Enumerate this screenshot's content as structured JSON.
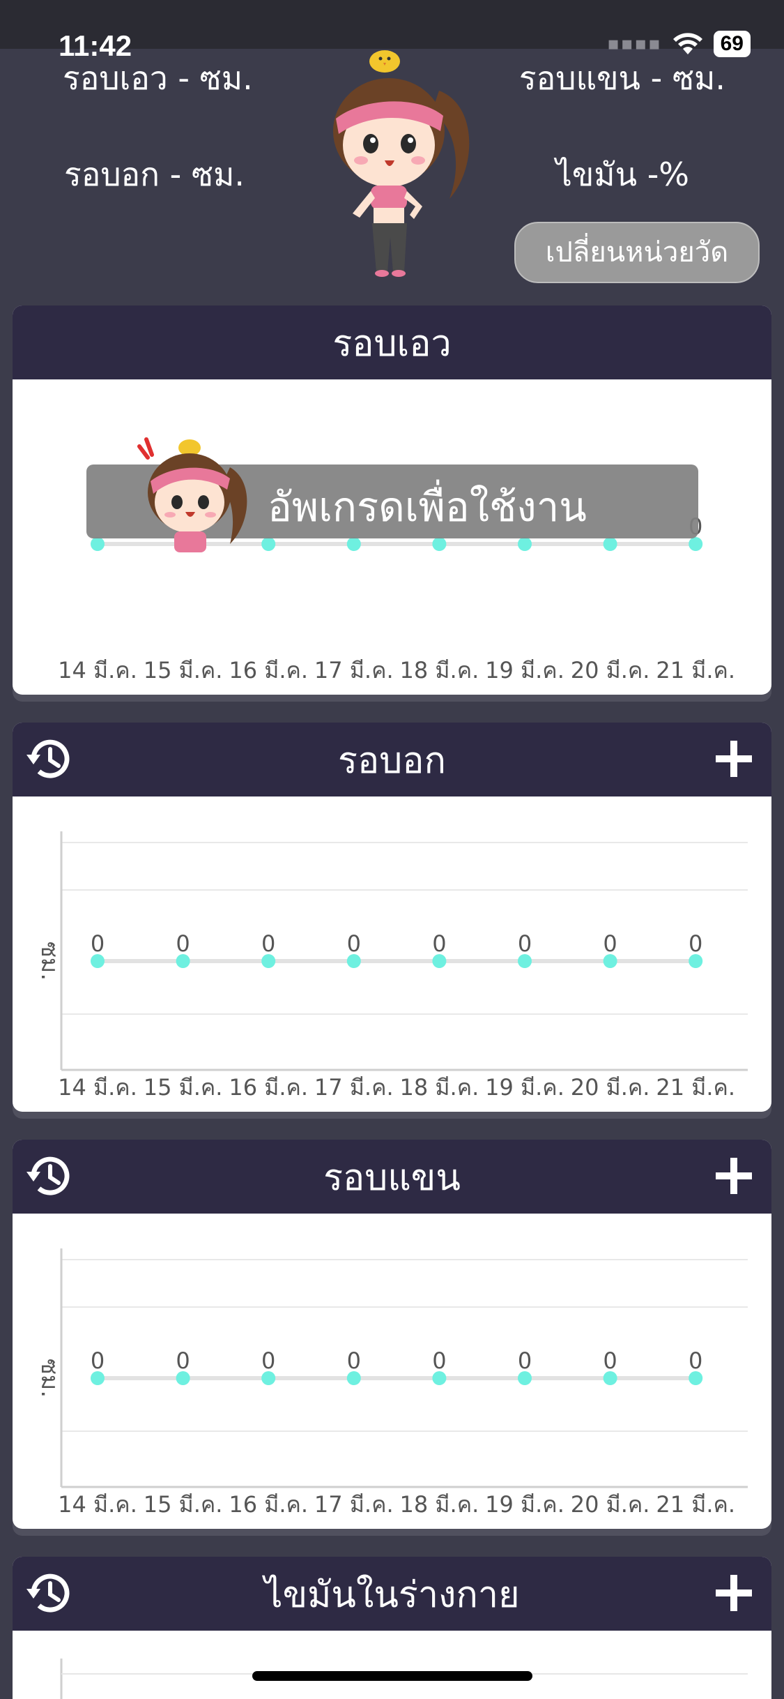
{
  "status_bar": {
    "time": "11:42",
    "battery": "69"
  },
  "summary": {
    "waist": "รอบเอว - ซม.",
    "arm": "รอบแขน - ซม.",
    "chest": "รอบอก - ซม.",
    "body_fat": "ไขมัน -%",
    "change_unit_button": "เปลี่ยนหน่วยวัด"
  },
  "upgrade": {
    "label": "อัพเกรดเพื่อใช้งาน"
  },
  "colors": {
    "header": "#2e2a44",
    "background": "#3c3c4b",
    "point": "#6ef0e0",
    "button": "#9a9a9a"
  },
  "cards": [
    {
      "title": "รอบเอว"
    },
    {
      "title": "รอบอก"
    },
    {
      "title": "รอบแขน"
    },
    {
      "title": "ไขมันในร่างกาย"
    }
  ],
  "chart_data": [
    {
      "type": "line",
      "categories": [
        "14 มี.ค.",
        "15 มี.ค.",
        "16 มี.ค.",
        "17 มี.ค.",
        "18 มี.ค.",
        "19 มี.ค.",
        "20 มี.ค.",
        "21 มี.ค."
      ],
      "series": [
        {
          "values": [
            0,
            0,
            0,
            0,
            0,
            0,
            0,
            0
          ]
        }
      ],
      "ylabel": "",
      "last_value_label": "0",
      "grid": false
    },
    {
      "type": "line",
      "categories": [
        "14 มี.ค.",
        "15 มี.ค.",
        "16 มี.ค.",
        "17 มี.ค.",
        "18 มี.ค.",
        "19 มี.ค.",
        "20 มี.ค.",
        "21 มี.ค."
      ],
      "series": [
        {
          "values": [
            0,
            0,
            0,
            0,
            0,
            0,
            0,
            0
          ]
        }
      ],
      "ylabel": "ซม.",
      "grid": true
    },
    {
      "type": "line",
      "categories": [
        "14 มี.ค.",
        "15 มี.ค.",
        "16 มี.ค.",
        "17 มี.ค.",
        "18 มี.ค.",
        "19 มี.ค.",
        "20 มี.ค.",
        "21 มี.ค."
      ],
      "series": [
        {
          "values": [
            0,
            0,
            0,
            0,
            0,
            0,
            0,
            0
          ]
        }
      ],
      "ylabel": "ซม.",
      "grid": true
    }
  ]
}
